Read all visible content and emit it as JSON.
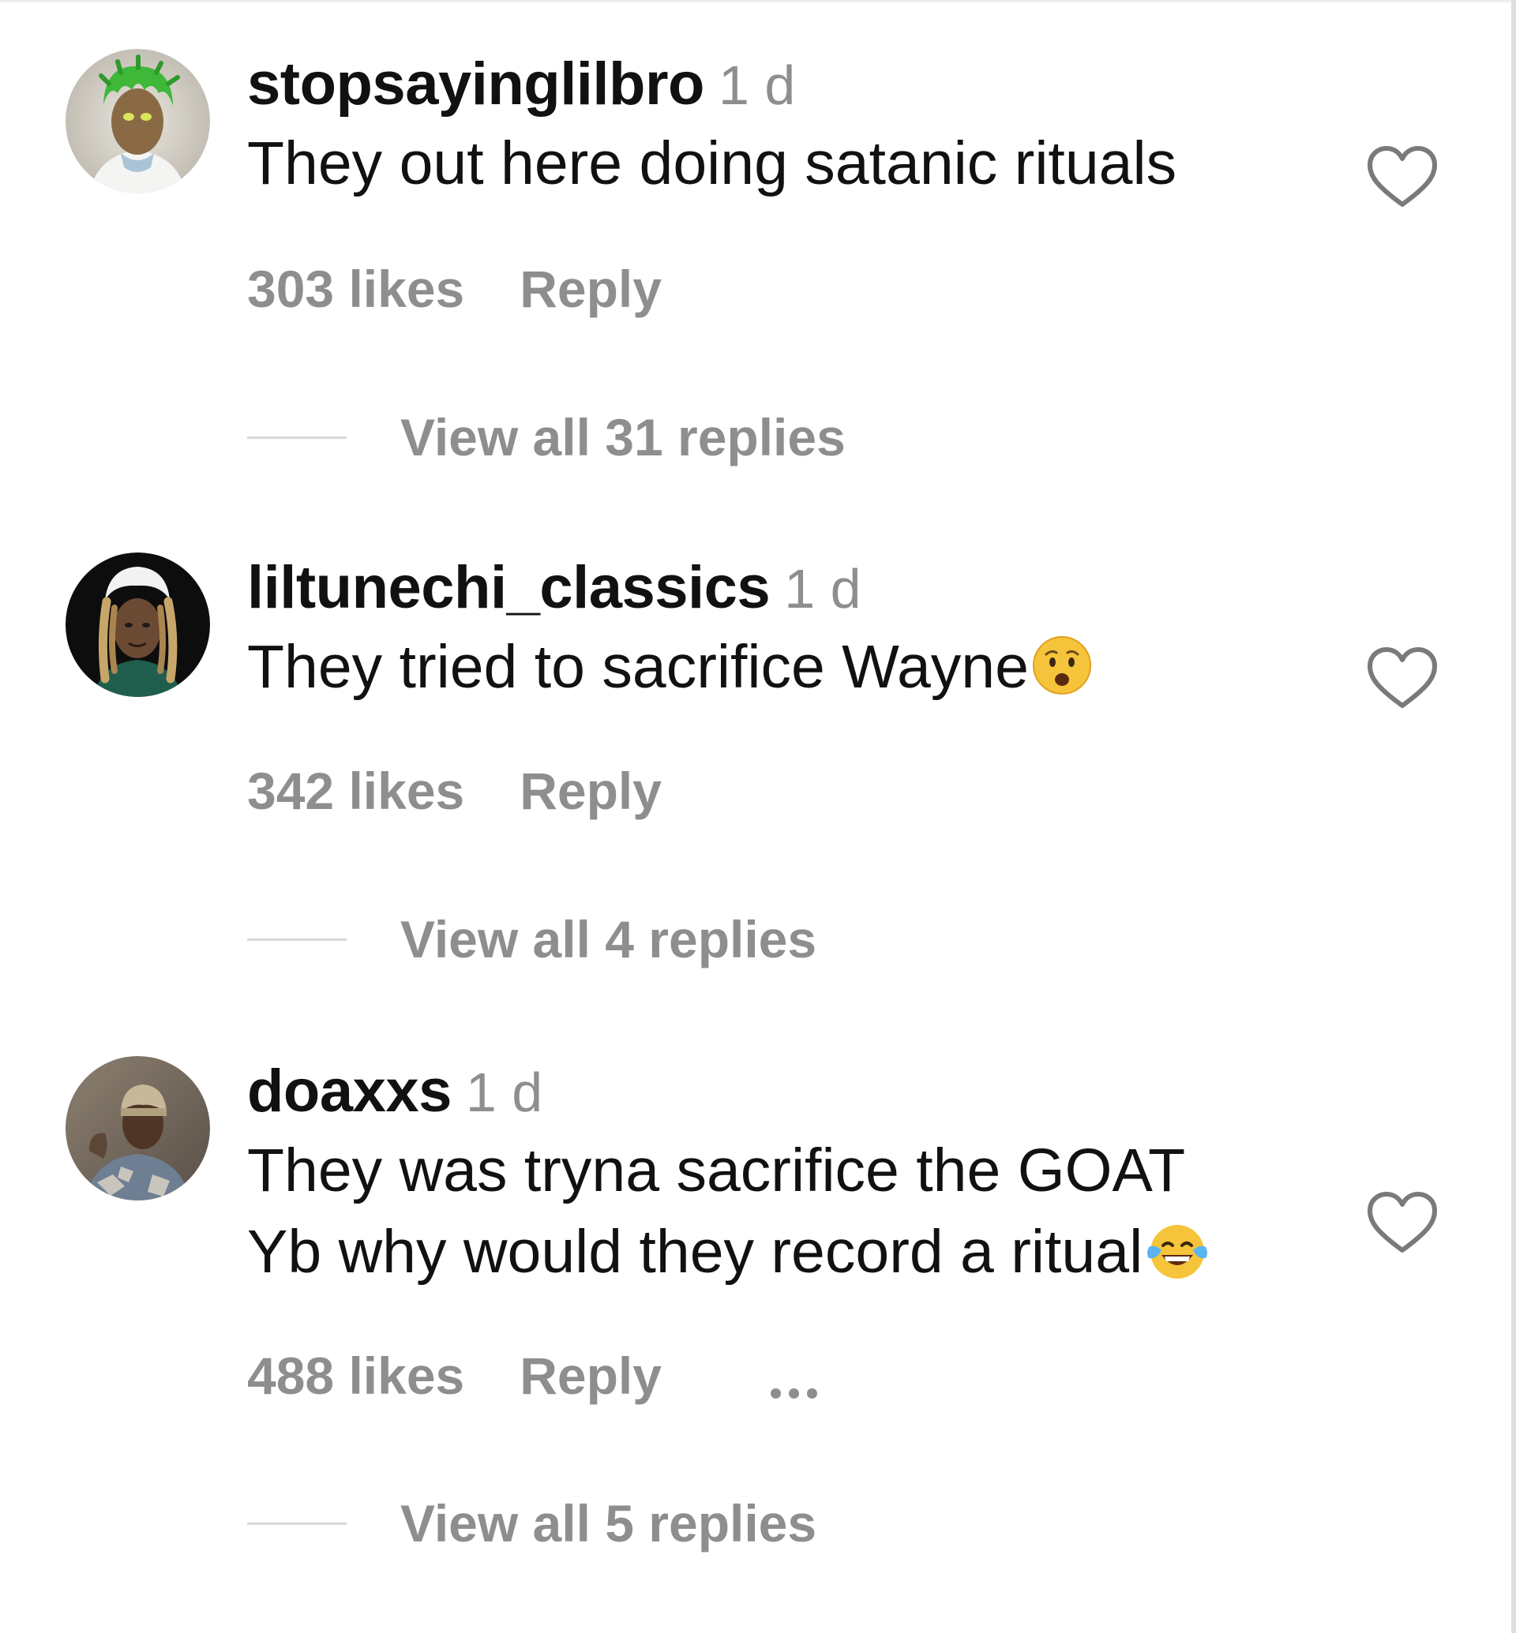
{
  "comments": [
    {
      "username": "stopsayinglilbro",
      "time": "1 d",
      "text": "They out here doing satanic rituals",
      "likes": "303 likes",
      "reply_label": "Reply",
      "view_replies": "View all 31 replies",
      "avatar": "green-hair-avatar",
      "emoji": ""
    },
    {
      "username": "liltunechi_classics",
      "time": "1 d",
      "text": "They tried to sacrifice Wayne",
      "likes": "342 likes",
      "reply_label": "Reply",
      "view_replies": "View all 4 replies",
      "avatar": "dreadlocks-avatar",
      "emoji": "😧"
    },
    {
      "username": "doaxxs",
      "time": "1 d",
      "text_line1": "They was tryna sacrifice the GOAT",
      "text_line2": "Yb why would they record a ritual",
      "likes": "488 likes",
      "reply_label": "Reply",
      "view_replies": "View all 5 replies",
      "avatar": "beanie-avatar",
      "emoji": "😂",
      "more_options": "ellipsis-icon"
    }
  ],
  "colors": {
    "text": "#111111",
    "secondary": "#8e8e8e",
    "divider": "#d8d8d8"
  }
}
